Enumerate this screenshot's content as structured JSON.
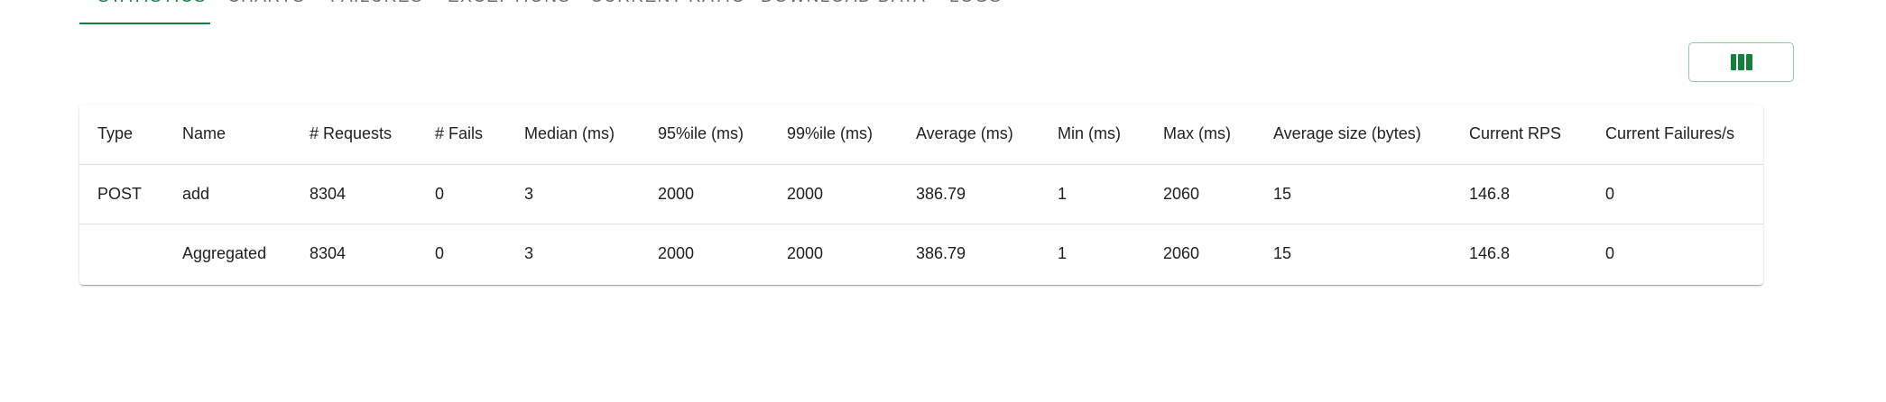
{
  "tabs": [
    {
      "label": "STATISTICS",
      "active": true
    },
    {
      "label": "CHARTS",
      "active": false
    },
    {
      "label": "FAILURES",
      "active": false
    },
    {
      "label": "EXCEPTIONS",
      "active": false
    },
    {
      "label": "CURRENT RATIO",
      "active": false
    },
    {
      "label": "DOWNLOAD DATA",
      "active": false
    },
    {
      "label": "LOGS",
      "active": false
    }
  ],
  "toolbar": {
    "columns_icon": "view-column-icon"
  },
  "colors": {
    "accent": "#15803d",
    "text": "#212121",
    "tab_inactive": "#6b6b6b",
    "divider": "#e0e0e0"
  },
  "table": {
    "headers": [
      "Type",
      "Name",
      "# Requests",
      "# Fails",
      "Median (ms)",
      "95%ile (ms)",
      "99%ile (ms)",
      "Average (ms)",
      "Min (ms)",
      "Max (ms)",
      "Average size (bytes)",
      "Current RPS",
      "Current Failures/s"
    ],
    "rows": [
      [
        "POST",
        "add",
        "8304",
        "0",
        "3",
        "2000",
        "2000",
        "386.79",
        "1",
        "2060",
        "15",
        "146.8",
        "0"
      ],
      [
        "",
        "Aggregated",
        "8304",
        "0",
        "3",
        "2000",
        "2000",
        "386.79",
        "1",
        "2060",
        "15",
        "146.8",
        "0"
      ]
    ]
  }
}
